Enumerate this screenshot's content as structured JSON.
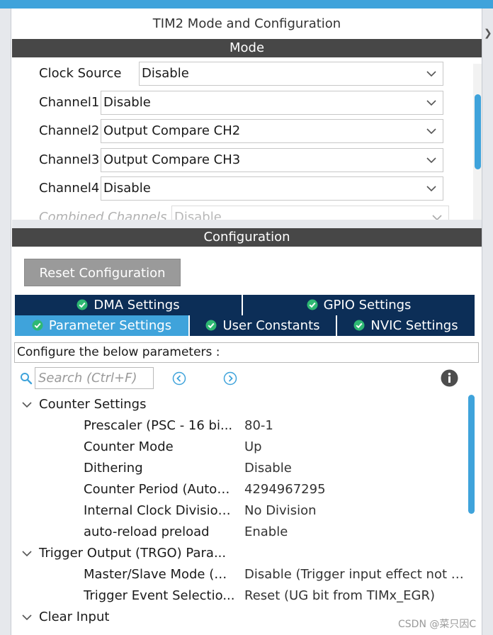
{
  "panel": {
    "title": "TIM2 Mode and Configuration"
  },
  "mode": {
    "header": "Mode",
    "rows": [
      {
        "label": "Clock Source",
        "value": "Disable"
      },
      {
        "label": "Channel1",
        "value": "Disable"
      },
      {
        "label": "Channel2",
        "value": "Output Compare CH2"
      },
      {
        "label": "Channel3",
        "value": "Output Compare CH3"
      },
      {
        "label": "Channel4",
        "value": "Disable"
      },
      {
        "label": "Combined Channels",
        "value": "Disable"
      }
    ]
  },
  "configuration": {
    "header": "Configuration",
    "reset_label": "Reset Configuration",
    "tabs_top": [
      {
        "label": "DMA Settings"
      },
      {
        "label": "GPIO Settings"
      }
    ],
    "tabs_bottom": [
      {
        "label": "Parameter Settings",
        "active": true
      },
      {
        "label": "User Constants"
      },
      {
        "label": "NVIC Settings"
      }
    ],
    "description": "Configure the below parameters :",
    "search_placeholder": "Search (Ctrl+F)",
    "groups": [
      {
        "name": "Counter Settings",
        "params": [
          {
            "name": "Prescaler (PSC - 16 bi...",
            "value": "80-1"
          },
          {
            "name": "Counter Mode",
            "value": "Up"
          },
          {
            "name": "Dithering",
            "value": "Disable"
          },
          {
            "name": "Counter Period (AutoR...",
            "value": "4294967295"
          },
          {
            "name": "Internal Clock Division ...",
            "value": "No Division"
          },
          {
            "name": "auto-reload preload",
            "value": "Enable"
          }
        ]
      },
      {
        "name": "Trigger Output (TRGO) Para...",
        "params": [
          {
            "name": "Master/Slave Mode (M...",
            "value": "Disable (Trigger input effect not d..."
          },
          {
            "name": "Trigger Event Selectio...",
            "value": "Reset (UG bit from TIMx_EGR)"
          }
        ]
      },
      {
        "name": "Clear Input",
        "params": []
      }
    ]
  },
  "watermark": "CSDN @菜只因C",
  "colors": {
    "accent": "#3fa3db",
    "tab_dark": "#0c2e57",
    "header_bar": "#474747",
    "check_green": "#2eb873",
    "button_gray": "#9a9a9a"
  }
}
